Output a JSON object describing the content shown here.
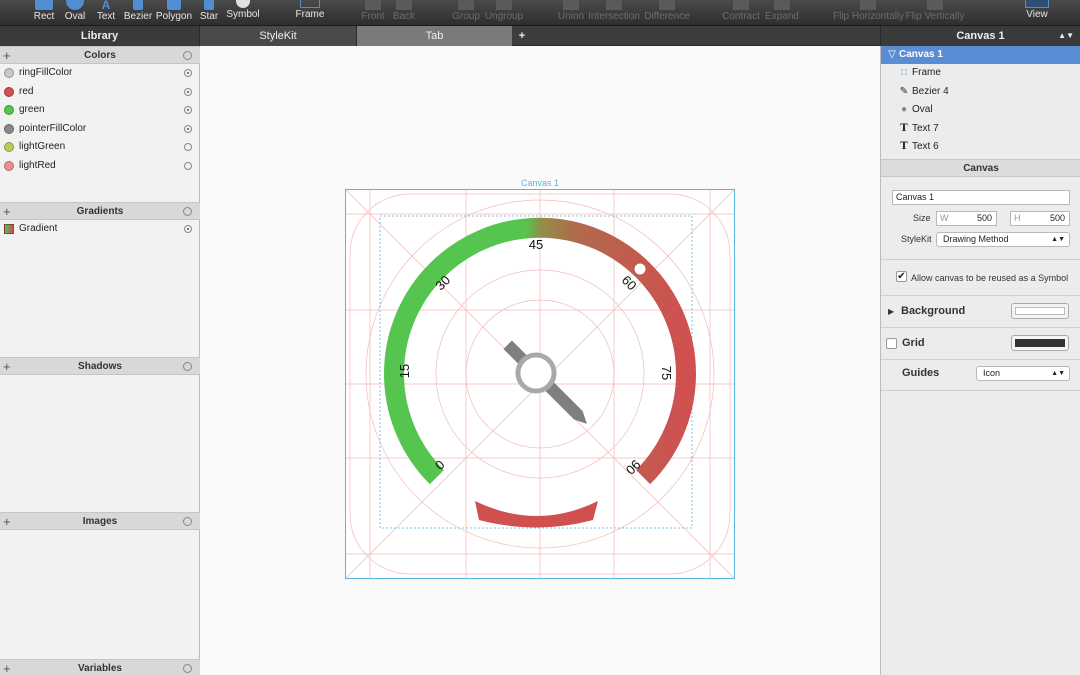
{
  "toolbar": {
    "tools": [
      {
        "label": "Rect",
        "icon": "rect-icon"
      },
      {
        "label": "Oval",
        "icon": "oval-icon"
      },
      {
        "label": "Text",
        "icon": "text-icon"
      },
      {
        "label": "Bezier",
        "icon": "bezier-icon"
      },
      {
        "label": "Polygon",
        "icon": "polygon-icon"
      },
      {
        "label": "Star",
        "icon": "star-icon"
      },
      {
        "label": "Symbol",
        "icon": "symbol-icon"
      },
      {
        "label": "Frame",
        "icon": "frame-icon"
      },
      {
        "label": "Front",
        "icon": "front-icon"
      },
      {
        "label": "Back",
        "icon": "back-icon"
      },
      {
        "label": "Group",
        "icon": "group-icon"
      },
      {
        "label": "Ungroup",
        "icon": "ungroup-icon"
      },
      {
        "label": "Union",
        "icon": "union-icon"
      },
      {
        "label": "Intersection",
        "icon": "intersection-icon"
      },
      {
        "label": "Difference",
        "icon": "difference-icon"
      },
      {
        "label": "Contract",
        "icon": "contract-icon"
      },
      {
        "label": "Expand",
        "icon": "expand-icon"
      },
      {
        "label": "Flip Horizontally",
        "icon": "flip-horizontal-icon"
      },
      {
        "label": "Flip Vertically",
        "icon": "flip-vertical-icon"
      },
      {
        "label": "View",
        "icon": "view-icon"
      }
    ]
  },
  "tabs": {
    "library": "Library",
    "stylekit": "StyleKit",
    "tab": "Tab",
    "add": "+",
    "inspector_title": "Canvas 1"
  },
  "library": {
    "colors_header": "Colors",
    "colors": [
      {
        "name": "ringFillColor",
        "color": "#c8c8c8",
        "selected": true
      },
      {
        "name": "red",
        "color": "#d05050",
        "selected": true
      },
      {
        "name": "green",
        "color": "#55c550",
        "selected": true
      },
      {
        "name": "pointerFillColor",
        "color": "#8a8a8a",
        "selected": true
      },
      {
        "name": "lightGreen",
        "color": "#b9cc5a",
        "selected": false
      },
      {
        "name": "lightRed",
        "color": "#ee8f8f",
        "selected": false
      }
    ],
    "gradients_header": "Gradients",
    "gradients": [
      {
        "name": "Gradient",
        "selected": true
      }
    ],
    "shadows_header": "Shadows",
    "images_header": "Images",
    "variables_header": "Variables"
  },
  "canvas": {
    "label": "Canvas 1",
    "ticks": [
      "0",
      "15",
      "30",
      "45",
      "60",
      "75",
      "90"
    ],
    "colors": {
      "green": "#55c550",
      "red": "#d05050",
      "pointer": "#7f7f7f",
      "ring": "#a9a9a9",
      "guide": "#f3b9b9",
      "frame": "#58b6e0"
    }
  },
  "inspector": {
    "tree": [
      {
        "label": "Canvas 1",
        "icon": "canvas-icon",
        "selected": true
      },
      {
        "label": "Frame",
        "icon": "frame-icon",
        "selected": false
      },
      {
        "label": "Bezier 4",
        "icon": "bezier-icon",
        "selected": false
      },
      {
        "label": "Oval",
        "icon": "oval-icon",
        "selected": false
      },
      {
        "label": "Text 7",
        "icon": "text-icon",
        "selected": false
      },
      {
        "label": "Text 6",
        "icon": "text-icon",
        "selected": false
      }
    ],
    "section_title": "Canvas",
    "name_value": "Canvas 1",
    "size_label": "Size",
    "w_prefix": "W",
    "w_value": "500",
    "h_prefix": "H",
    "h_value": "500",
    "stylekit_label": "StyleKit",
    "stylekit_value": "Drawing Method",
    "reuse_label": "Allow canvas to be reused as a Symbol",
    "reuse_checked": true,
    "background_label": "Background",
    "grid_label": "Grid",
    "guides_label": "Guides",
    "guides_value": "Icon"
  }
}
